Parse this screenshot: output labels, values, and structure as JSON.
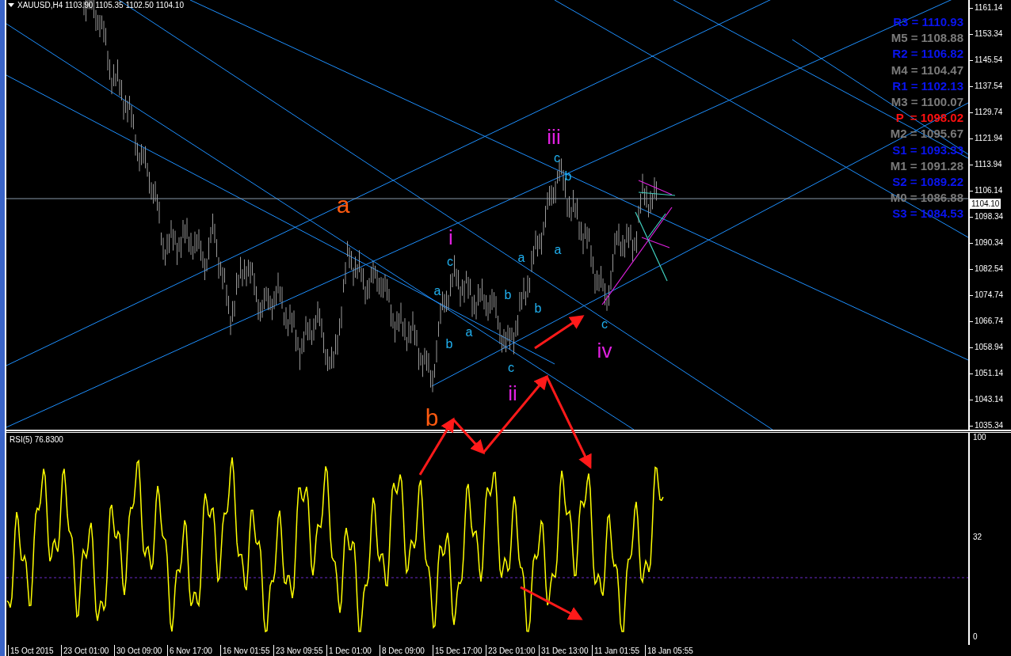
{
  "header": {
    "title": "XAUUSD,H4 1103.90 1105.35 1102.50 1104.10"
  },
  "price_chart": {
    "price_ticks": [
      "1161.14",
      "1153.34",
      "1145.54",
      "1137.54",
      "1129.74",
      "1121.94",
      "1113.94",
      "1106.14",
      "1098.34",
      "1090.34",
      "1082.54",
      "1074.74",
      "1066.74",
      "1058.94",
      "1051.14",
      "1043.14",
      "1035.34"
    ],
    "current_price": "1104.10",
    "pivots": [
      {
        "label": "R3 = 1110.93",
        "kind": "resistance"
      },
      {
        "label": "M5 = 1108.88",
        "kind": "mid"
      },
      {
        "label": "R2 = 1106.82",
        "kind": "resistance"
      },
      {
        "label": "M4 = 1104.47",
        "kind": "mid"
      },
      {
        "label": "R1 = 1102.13",
        "kind": "resistance"
      },
      {
        "label": "M3 = 1100.07",
        "kind": "mid"
      },
      {
        "label": "P  = 1098.02",
        "kind": "pivot"
      },
      {
        "label": "M2 = 1095.67",
        "kind": "mid"
      },
      {
        "label": "S1 = 1093.33",
        "kind": "support"
      },
      {
        "label": "M1 = 1091.28",
        "kind": "mid"
      },
      {
        "label": "S2 = 1089.22",
        "kind": "support"
      },
      {
        "label": "M0 = 1086.88",
        "kind": "mid"
      },
      {
        "label": "S3 = 1084.53",
        "kind": "support"
      }
    ],
    "wave_labels": [
      {
        "text": "iii",
        "color": "#e020e0"
      },
      {
        "text": "c",
        "color": "#20b0f0"
      },
      {
        "text": "b",
        "color": "#20b0f0"
      },
      {
        "text": "a",
        "color": "#ff5a10"
      },
      {
        "text": "i",
        "color": "#e020e0"
      },
      {
        "text": "a",
        "color": "#20b0f0"
      },
      {
        "text": "a",
        "color": "#20b0f0"
      },
      {
        "text": "c",
        "color": "#20b0f0"
      },
      {
        "text": "a",
        "color": "#20b0f0"
      },
      {
        "text": "b",
        "color": "#20b0f0"
      },
      {
        "text": "b",
        "color": "#20b0f0"
      },
      {
        "text": "c",
        "color": "#20b0f0"
      },
      {
        "text": "a",
        "color": "#20b0f0"
      },
      {
        "text": "b",
        "color": "#20b0f0"
      },
      {
        "text": "iv",
        "color": "#e020e0"
      },
      {
        "text": "c",
        "color": "#20b0f0"
      },
      {
        "text": "ii",
        "color": "#e020e0"
      },
      {
        "text": "b",
        "color": "#ff5a10"
      }
    ]
  },
  "rsi": {
    "title": "RSI(5) 76.8300",
    "ticks": [
      "100",
      "32",
      "0"
    ]
  },
  "time_axis": {
    "labels": [
      "15 Oct 2015",
      "23 Oct 01:00",
      "30 Oct 09:00",
      "6 Nov 17:00",
      "16 Nov 01:55",
      "23 Nov 09:55",
      "1 Dec 01:00",
      "8 Dec 09:00",
      "15 Dec 17:00",
      "23 Dec 01:00",
      "31 Dec 13:00",
      "11 Jan 01:55",
      "18 Jan 05:55"
    ]
  }
}
